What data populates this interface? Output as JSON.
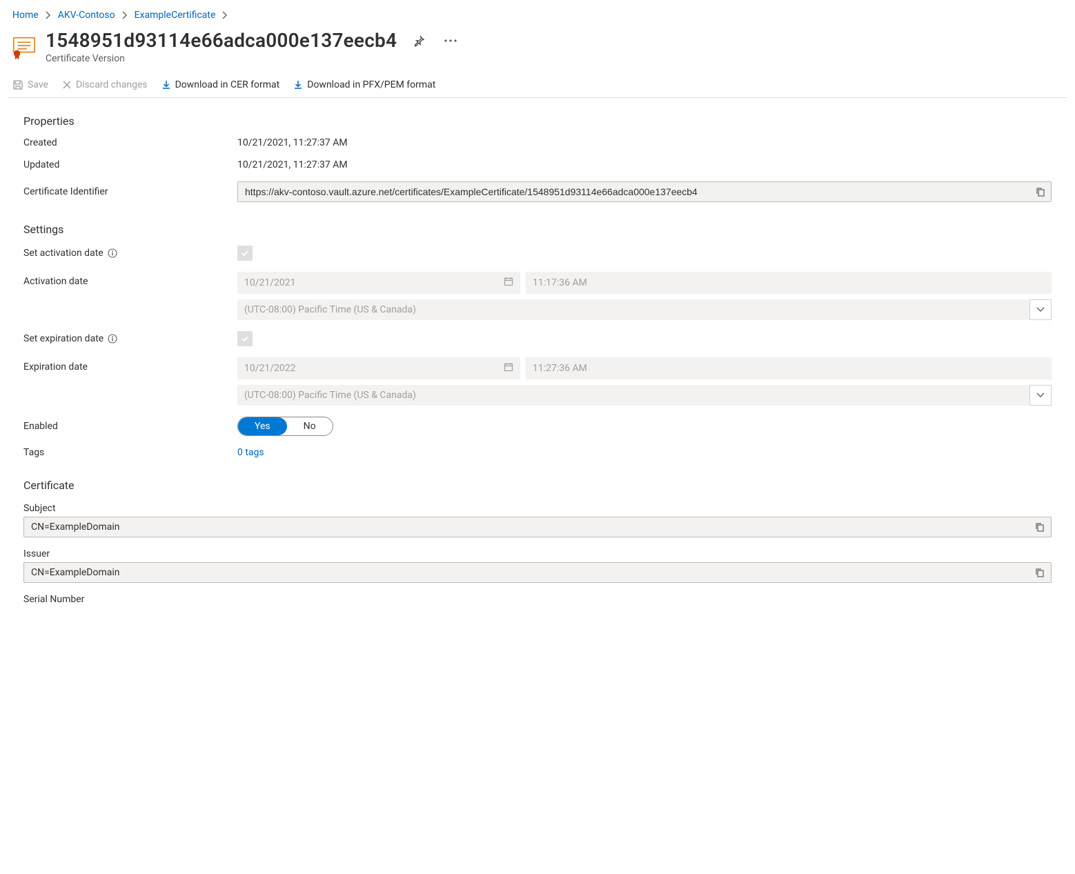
{
  "breadcrumb": {
    "home": "Home",
    "vault": "AKV-Contoso",
    "certificate": "ExampleCertificate"
  },
  "header": {
    "title": "1548951d93114e66adca000e137eecb4",
    "subtitle": "Certificate Version"
  },
  "commands": {
    "save": "Save",
    "discard": "Discard changes",
    "download_cer": "Download in CER format",
    "download_pfx": "Download in PFX/PEM format"
  },
  "sections": {
    "properties": "Properties",
    "settings": "Settings",
    "certificate": "Certificate"
  },
  "properties": {
    "created_label": "Created",
    "created_value": "10/21/2021, 11:27:37 AM",
    "updated_label": "Updated",
    "updated_value": "10/21/2021, 11:27:37 AM",
    "identifier_label": "Certificate Identifier",
    "identifier_value": "https://akv-contoso.vault.azure.net/certificates/ExampleCertificate/1548951d93114e66adca000e137eecb4"
  },
  "settings": {
    "set_activation_label": "Set activation date",
    "activation_date_label": "Activation date",
    "activation_date": "10/21/2021",
    "activation_time": "11:17:36 AM",
    "timezone": "(UTC-08:00) Pacific Time (US & Canada)",
    "set_expiration_label": "Set expiration date",
    "expiration_date_label": "Expiration date",
    "expiration_date": "10/21/2022",
    "expiration_time": "11:27:36 AM",
    "enabled_label": "Enabled",
    "enabled_yes": "Yes",
    "enabled_no": "No",
    "tags_label": "Tags",
    "tags_value": "0 tags"
  },
  "certificate": {
    "subject_label": "Subject",
    "subject_value": "CN=ExampleDomain",
    "issuer_label": "Issuer",
    "issuer_value": "CN=ExampleDomain",
    "serial_label": "Serial Number"
  }
}
